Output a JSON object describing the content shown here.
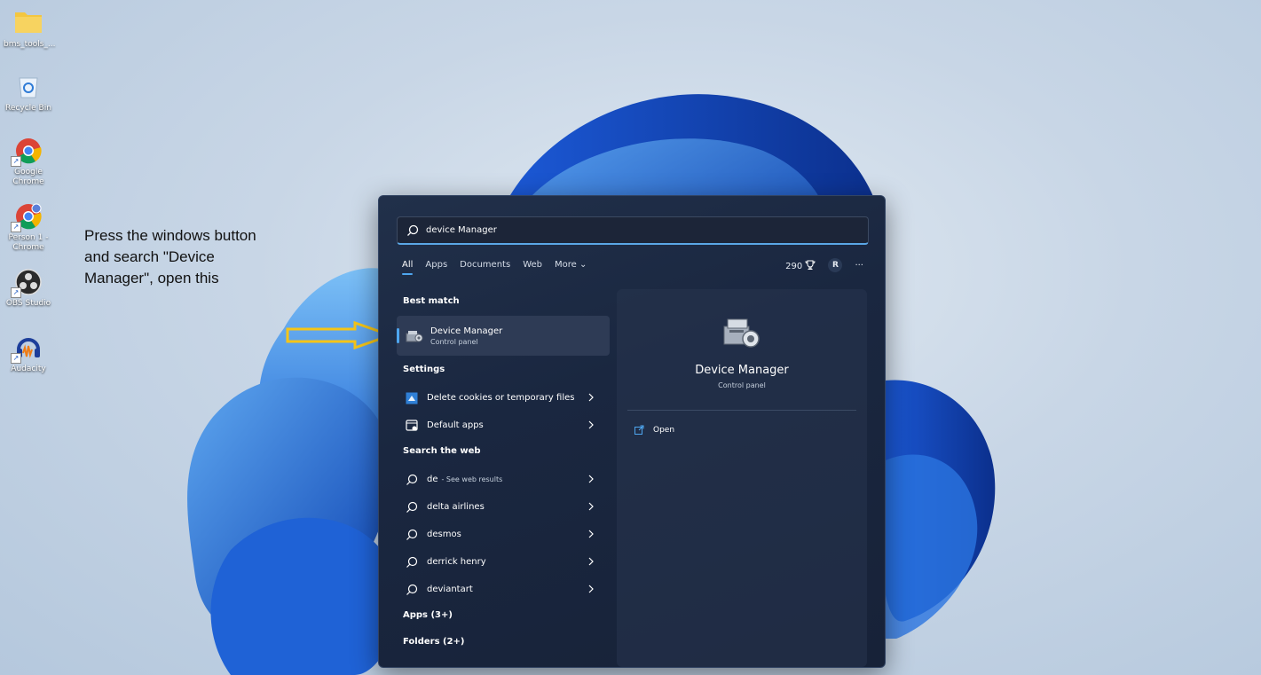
{
  "desktop": {
    "icons": [
      {
        "label": "bms_tools_...",
        "icon": "folder-icon"
      },
      {
        "label": "Recycle Bin",
        "icon": "recycle-bin-icon"
      },
      {
        "label": "Google Chrome",
        "icon": "chrome-icon"
      },
      {
        "label": "Person 1 - Chrome",
        "icon": "chrome-profile-icon"
      },
      {
        "label": "OBS Studio",
        "icon": "obs-icon"
      },
      {
        "label": "Audacity",
        "icon": "audacity-icon"
      }
    ]
  },
  "annotation": {
    "text": "Press the windows button and search \"Device Manager\", open this",
    "arrow_color": "#f5c518"
  },
  "search": {
    "query": "device Manager",
    "tabs": [
      "All",
      "Apps",
      "Documents",
      "Web",
      "More ⌄"
    ],
    "active_tab": "All",
    "points": "290",
    "avatar_letter": "R",
    "more_menu": "···"
  },
  "results": {
    "best_match_title": "Best match",
    "best_match": {
      "name": "Device Manager",
      "type": "Control panel"
    },
    "settings_title": "Settings",
    "settings": [
      {
        "label": "Delete cookies or temporary files",
        "icon": "cookies-settings-icon"
      },
      {
        "label": "Default apps",
        "icon": "default-apps-icon"
      }
    ],
    "web_title": "Search the web",
    "web": [
      {
        "label": "de",
        "sub": "- See web results"
      },
      {
        "label": "delta airlines",
        "sub": ""
      },
      {
        "label": "desmos",
        "sub": ""
      },
      {
        "label": "derrick henry",
        "sub": ""
      },
      {
        "label": "deviantart",
        "sub": ""
      }
    ],
    "apps_title": "Apps (3+)",
    "folders_title": "Folders (2+)"
  },
  "preview": {
    "title": "Device Manager",
    "subtitle": "Control panel",
    "open_label": "Open"
  },
  "colors": {
    "accent": "#4ea6ef",
    "panel_bg": "#1a2740",
    "highlight": "#2e3b55"
  }
}
